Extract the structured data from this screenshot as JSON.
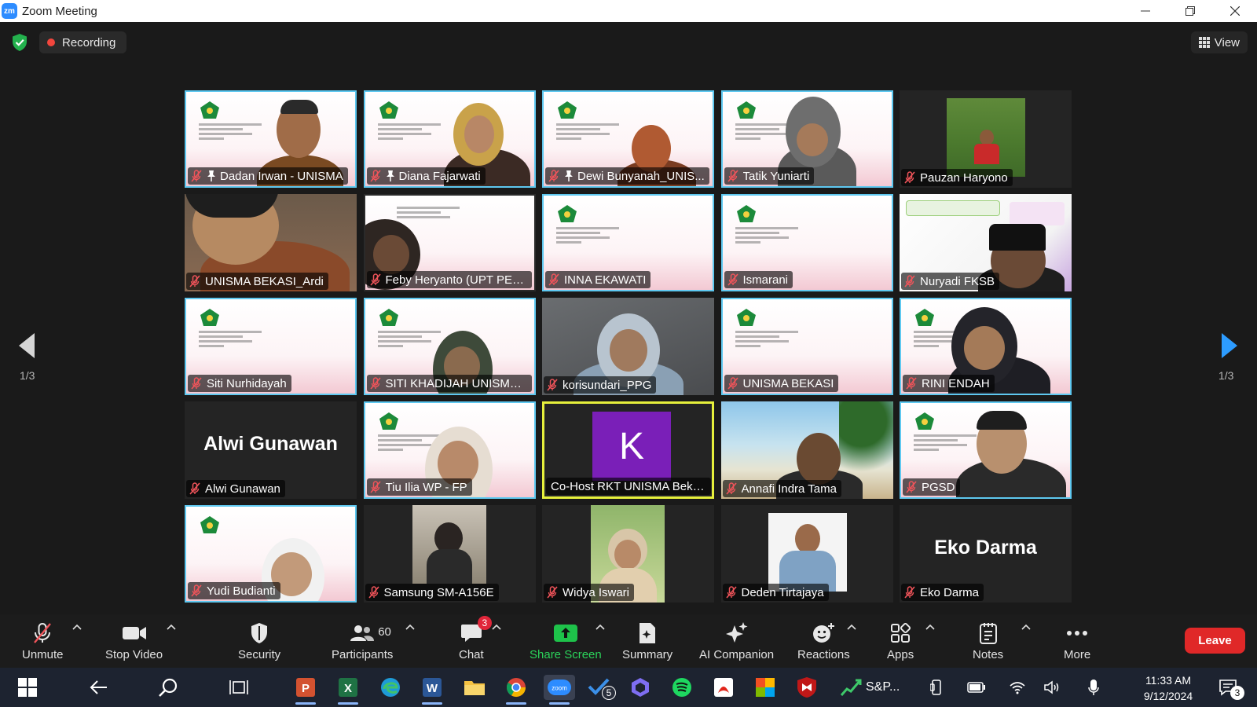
{
  "window": {
    "app_icon": "zm",
    "title": "Zoom Meeting"
  },
  "meeting": {
    "recording_label": "Recording",
    "view_label": "View",
    "page_left": "1/3",
    "page_right": "1/3"
  },
  "tiles": [
    {
      "name": "Dadan Irwan - UNISMA",
      "pinned": true
    },
    {
      "name": "Diana Fajarwati",
      "pinned": true
    },
    {
      "name": "Dewi Bunyanah_UNIS...",
      "pinned": true
    },
    {
      "name": "Tatik Yuniarti"
    },
    {
      "name": "Pauzan Haryono"
    },
    {
      "name": "UNISMA BEKASI_Ardi"
    },
    {
      "name": "Feby Heryanto (UPT PERP..."
    },
    {
      "name": "INNA EKAWATI"
    },
    {
      "name": "Ismarani"
    },
    {
      "name": "Nuryadi FKSB"
    },
    {
      "name": "Siti Nurhidayah"
    },
    {
      "name": "SITI KHADIJAH UNISMA B..."
    },
    {
      "name": "korisundari_PPG"
    },
    {
      "name": "UNISMA BEKASI"
    },
    {
      "name": "RINI ENDAH"
    },
    {
      "name": "Alwi Gunawan",
      "display_name": "Alwi Gunawan"
    },
    {
      "name": "Tiu Ilia WP - FP"
    },
    {
      "name": "Co-Host RKT UNISMA Bekasi",
      "avatar_letter": "K",
      "active_speaker": true
    },
    {
      "name": "Annafi Indra Tama"
    },
    {
      "name": "PGSD"
    },
    {
      "name": "Yudi Budianti"
    },
    {
      "name": "Samsung SM-A156E"
    },
    {
      "name": "Widya Iswari"
    },
    {
      "name": "Deden Tirtajaya"
    },
    {
      "name": "Eko Darma",
      "display_name": "Eko Darma"
    }
  ],
  "toolbar": {
    "unmute": "Unmute",
    "stop_video": "Stop Video",
    "security": "Security",
    "participants": "Participants",
    "participants_count": "60",
    "chat": "Chat",
    "chat_badge": "3",
    "share_screen": "Share Screen",
    "summary": "Summary",
    "ai_companion": "AI Companion",
    "reactions": "Reactions",
    "apps": "Apps",
    "notes": "Notes",
    "more": "More",
    "leave": "Leave",
    "share_color": "#1ec24a",
    "leave_color": "#e02828"
  },
  "taskbar": {
    "time": "11:33 AM",
    "date": "9/12/2024",
    "sp_label": "S&P...",
    "todo_badge": "5",
    "notif_badge": "3"
  }
}
